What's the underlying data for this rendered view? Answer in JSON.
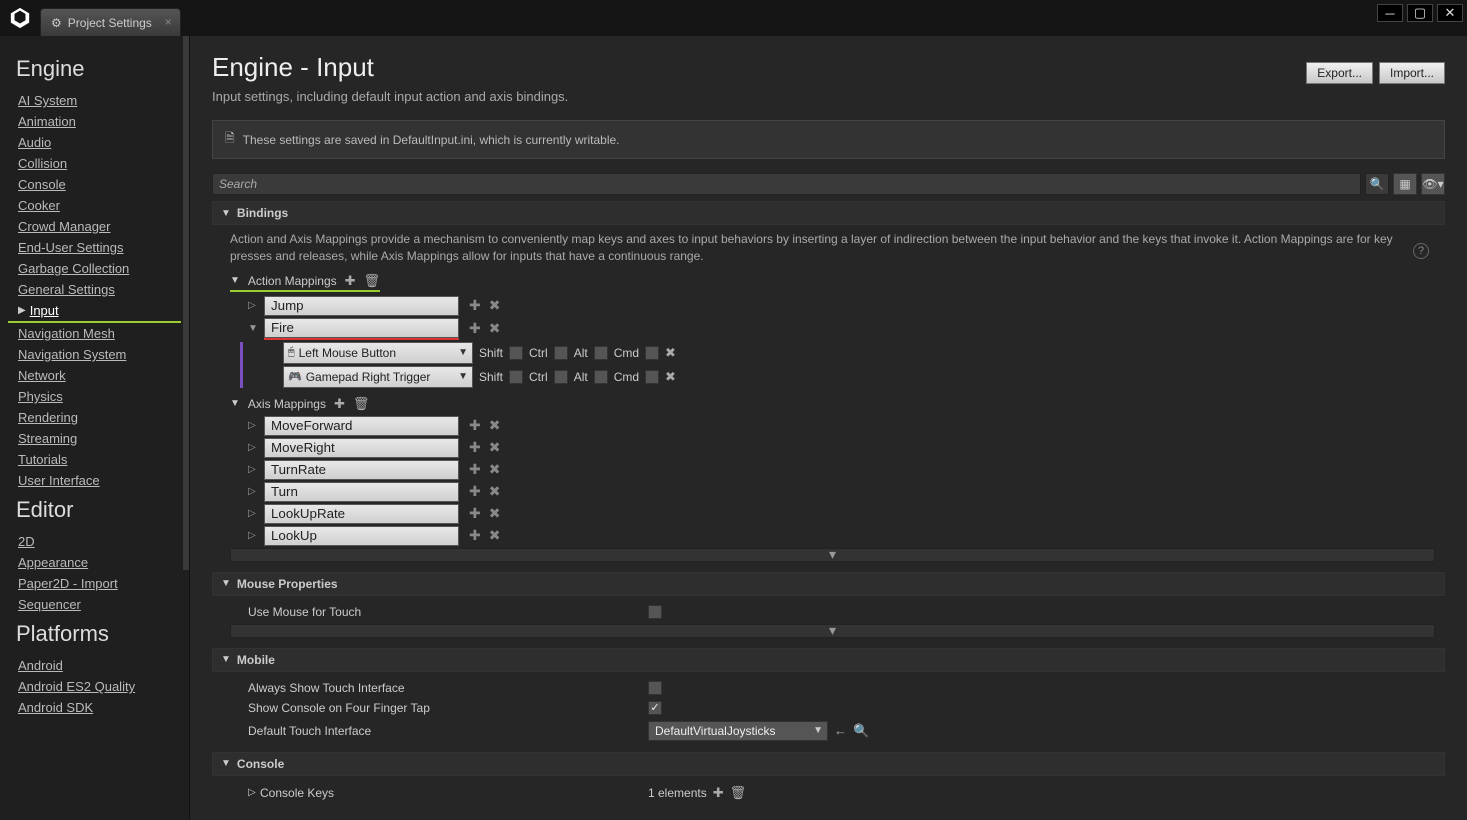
{
  "window": {
    "tab_title": "Project Settings"
  },
  "sidebar": {
    "categories": [
      {
        "name": "Engine",
        "items": [
          "AI System",
          "Animation",
          "Audio",
          "Collision",
          "Console",
          "Cooker",
          "Crowd Manager",
          "End-User Settings",
          "Garbage Collection",
          "General Settings",
          "Input",
          "Navigation Mesh",
          "Navigation System",
          "Network",
          "Physics",
          "Rendering",
          "Streaming",
          "Tutorials",
          "User Interface"
        ]
      },
      {
        "name": "Editor",
        "items": [
          "2D",
          "Appearance",
          "Paper2D - Import",
          "Sequencer"
        ]
      },
      {
        "name": "Platforms",
        "items": [
          "Android",
          "Android ES2 Quality",
          "Android SDK"
        ]
      }
    ],
    "active": "Input"
  },
  "header": {
    "title": "Engine - Input",
    "subtitle": "Input settings, including default input action and axis bindings.",
    "export": "Export...",
    "import": "Import..."
  },
  "info_message": "These settings are saved in DefaultInput.ini, which is currently writable.",
  "search_placeholder": "Search",
  "bindings": {
    "title": "Bindings",
    "description": "Action and Axis Mappings provide a mechanism to conveniently map keys and axes to input behaviors by inserting a layer of indirection between the input behavior and the keys that invoke it. Action Mappings are for key presses and releases, while Axis Mappings allow for inputs that have a continuous range.",
    "action_label": "Action Mappings",
    "axis_label": "Axis Mappings",
    "action_mappings": [
      {
        "name": "Jump",
        "expanded": false
      },
      {
        "name": "Fire",
        "expanded": true,
        "keys": [
          {
            "key": "Left Mouse Button",
            "icon": "mouse"
          },
          {
            "key": "Gamepad Right Trigger",
            "icon": "gamepad"
          }
        ]
      }
    ],
    "modifiers": [
      "Shift",
      "Ctrl",
      "Alt",
      "Cmd"
    ],
    "axis_mappings": [
      {
        "name": "MoveForward"
      },
      {
        "name": "MoveRight"
      },
      {
        "name": "TurnRate"
      },
      {
        "name": "Turn"
      },
      {
        "name": "LookUpRate"
      },
      {
        "name": "LookUp"
      }
    ]
  },
  "mouse_section": {
    "title": "Mouse Properties",
    "use_mouse_for_touch": "Use Mouse for Touch"
  },
  "mobile_section": {
    "title": "Mobile",
    "always_show": "Always Show Touch Interface",
    "four_finger": "Show Console on Four Finger Tap",
    "touch_iface": "Default Touch Interface",
    "touch_iface_value": "DefaultVirtualJoysticks"
  },
  "console_section": {
    "title": "Console",
    "keys_label": "Console Keys",
    "keys_value": "1 elements"
  }
}
